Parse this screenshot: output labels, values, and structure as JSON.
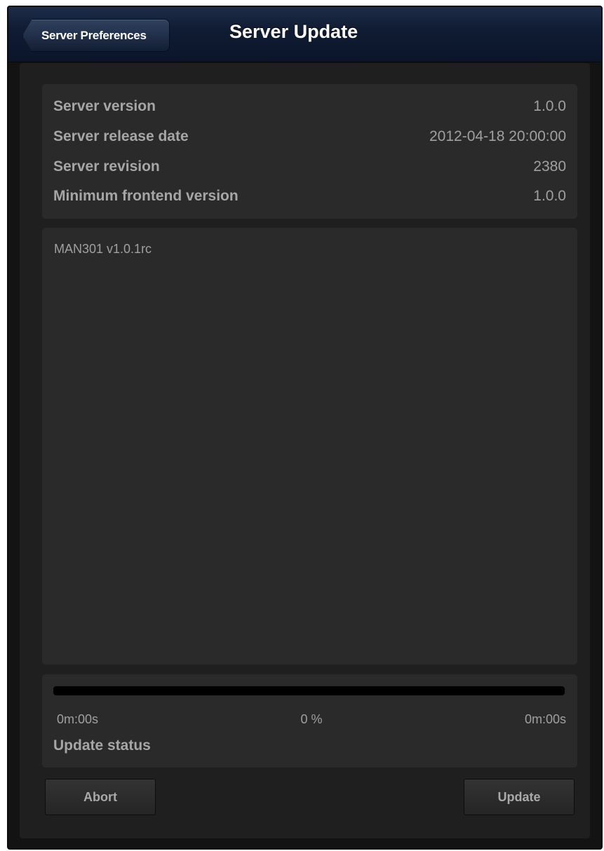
{
  "navbar": {
    "back_label": "Server Preferences",
    "title": "Server Update"
  },
  "info": {
    "rows": [
      {
        "label": "Server version",
        "value": "1.0.0"
      },
      {
        "label": "Server release date",
        "value": "2012-04-18 20:00:00"
      },
      {
        "label": "Server revision",
        "value": "2380"
      },
      {
        "label": "Minimum frontend version",
        "value": "1.0.0"
      }
    ]
  },
  "log": {
    "text": "MAN301 v1.0.1rc"
  },
  "progress": {
    "fraction": 0,
    "elapsed": "0m:00s",
    "percent": "0 %",
    "remaining": "0m:00s",
    "status_label": "Update status"
  },
  "actions": {
    "abort_label": "Abort",
    "update_label": "Update"
  },
  "colors": {
    "navbar": "#101c33",
    "panel": "#2a2a2a",
    "background": "#1f1f1f",
    "progress_track": "#000000"
  }
}
